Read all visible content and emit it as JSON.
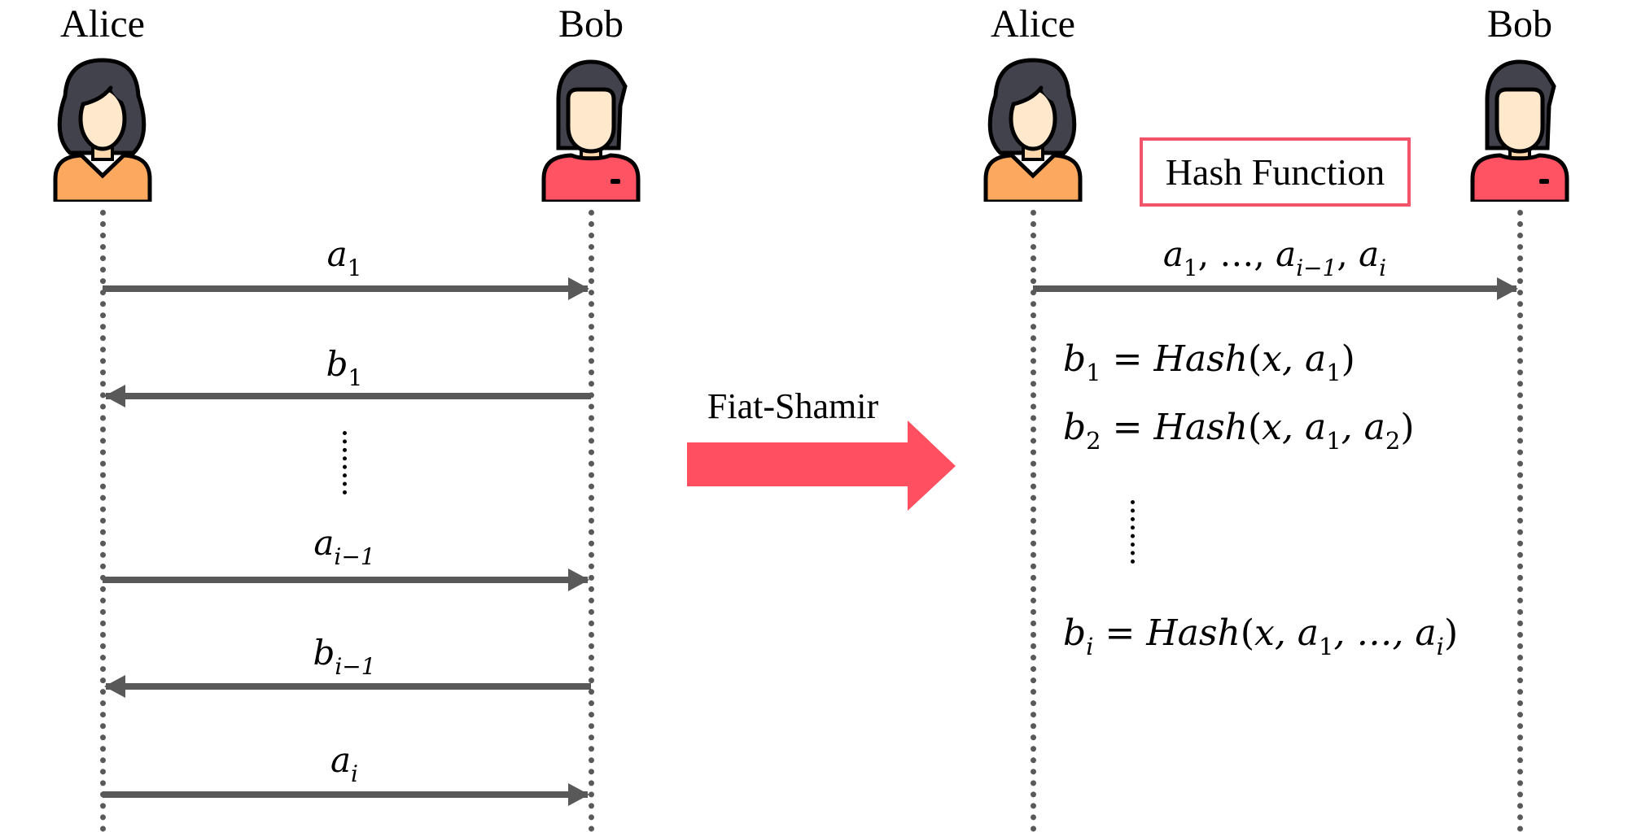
{
  "participants": {
    "alice": "Alice",
    "bob": "Bob"
  },
  "colors": {
    "arrow": "#595959",
    "accent": "#ff4f61",
    "alice_shirt": "#fca85e",
    "bob_shirt": "#ff5263",
    "hair": "#42424c",
    "skin": "#ffe8cc"
  },
  "left": {
    "messages": [
      {
        "var": "a",
        "sub": "1",
        "direction": "alice-to-bob"
      },
      {
        "var": "b",
        "sub": "1",
        "direction": "bob-to-alice"
      },
      {
        "var": "a",
        "sub": "i−1",
        "direction": "alice-to-bob"
      },
      {
        "var": "b",
        "sub": "i−1",
        "direction": "bob-to-alice"
      },
      {
        "var": "a",
        "sub": "i",
        "direction": "alice-to-bob"
      }
    ]
  },
  "transform": {
    "label": "Fiat-Shamir"
  },
  "right": {
    "hash_box": "Hash Function",
    "message": {
      "v1": "a",
      "s1": "1",
      "sep1": ", …, ",
      "v2": "a",
      "s2": "i−1",
      "sep2": ", ",
      "v3": "a",
      "s3": "i"
    },
    "equations": [
      {
        "lhs": "b",
        "lsub": "1",
        "eq": " = ",
        "fn": "Hash",
        "open": "(",
        "args": "x, a",
        "asub": "1",
        "rest": "",
        "close": ")"
      },
      {
        "lhs": "b",
        "lsub": "2",
        "eq": " = ",
        "fn": "Hash",
        "open": "(",
        "args": "x, a",
        "asub": "1",
        "rest": ", a",
        "rsub": "2",
        "close": ")"
      },
      {
        "lhs": "b",
        "lsub": "i",
        "eq": " = ",
        "fn": "Hash",
        "open": "(",
        "args": "x, a",
        "asub": "1",
        "rest": ", …, a",
        "rsub": "i",
        "close": ")"
      }
    ]
  }
}
